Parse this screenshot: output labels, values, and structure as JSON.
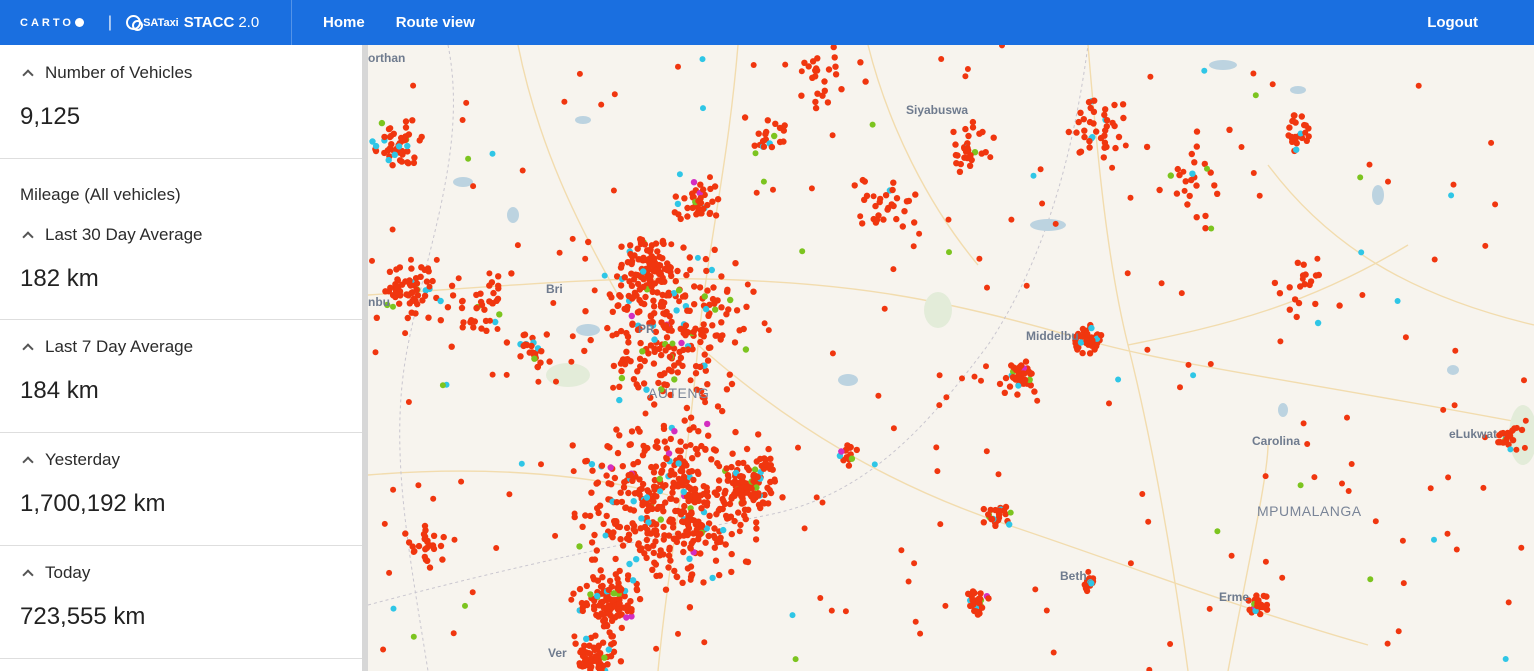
{
  "header": {
    "carto_logo_text": "CARTO",
    "separator": "|",
    "sataxi_text": "SATaxi",
    "app_title": "STACC",
    "app_version": "2.0",
    "nav": [
      {
        "label": "Home"
      },
      {
        "label": "Route view"
      }
    ],
    "logout_label": "Logout"
  },
  "sidebar": {
    "vehicles": {
      "title": "Number of Vehicles",
      "value": "9,125"
    },
    "mileage_group_title": "Mileage (All vehicles)",
    "last30": {
      "title": "Last 30 Day Average",
      "value": "182 km"
    },
    "last7": {
      "title": "Last 7 Day Average",
      "value": "184 km"
    },
    "yesterday": {
      "title": "Yesterday",
      "value": "1,700,192 km"
    },
    "today": {
      "title": "Today",
      "value": "723,555 km"
    }
  },
  "map": {
    "place_labels": {
      "p1": "orthan",
      "p2": "Siyabuswa",
      "p3": "Bri",
      "p4": "nbu",
      "p5": "PR",
      "p6": "AUTENG",
      "p7": "Middelbu",
      "p8": "Carolina",
      "p9": "eLukwat",
      "p10": "MPUMALANGA",
      "p11": "Beth",
      "p12": "Erme",
      "p13": "Ver"
    },
    "colors": {
      "vehicle_primary": "#f0360f",
      "vehicle_cyan": "#2fc6e6",
      "vehicle_green": "#7cc41f",
      "vehicle_magenta": "#d32ec0",
      "background": "#f7f4ee",
      "roads": "#f4d9a3",
      "water": "#bcd3e0"
    }
  }
}
